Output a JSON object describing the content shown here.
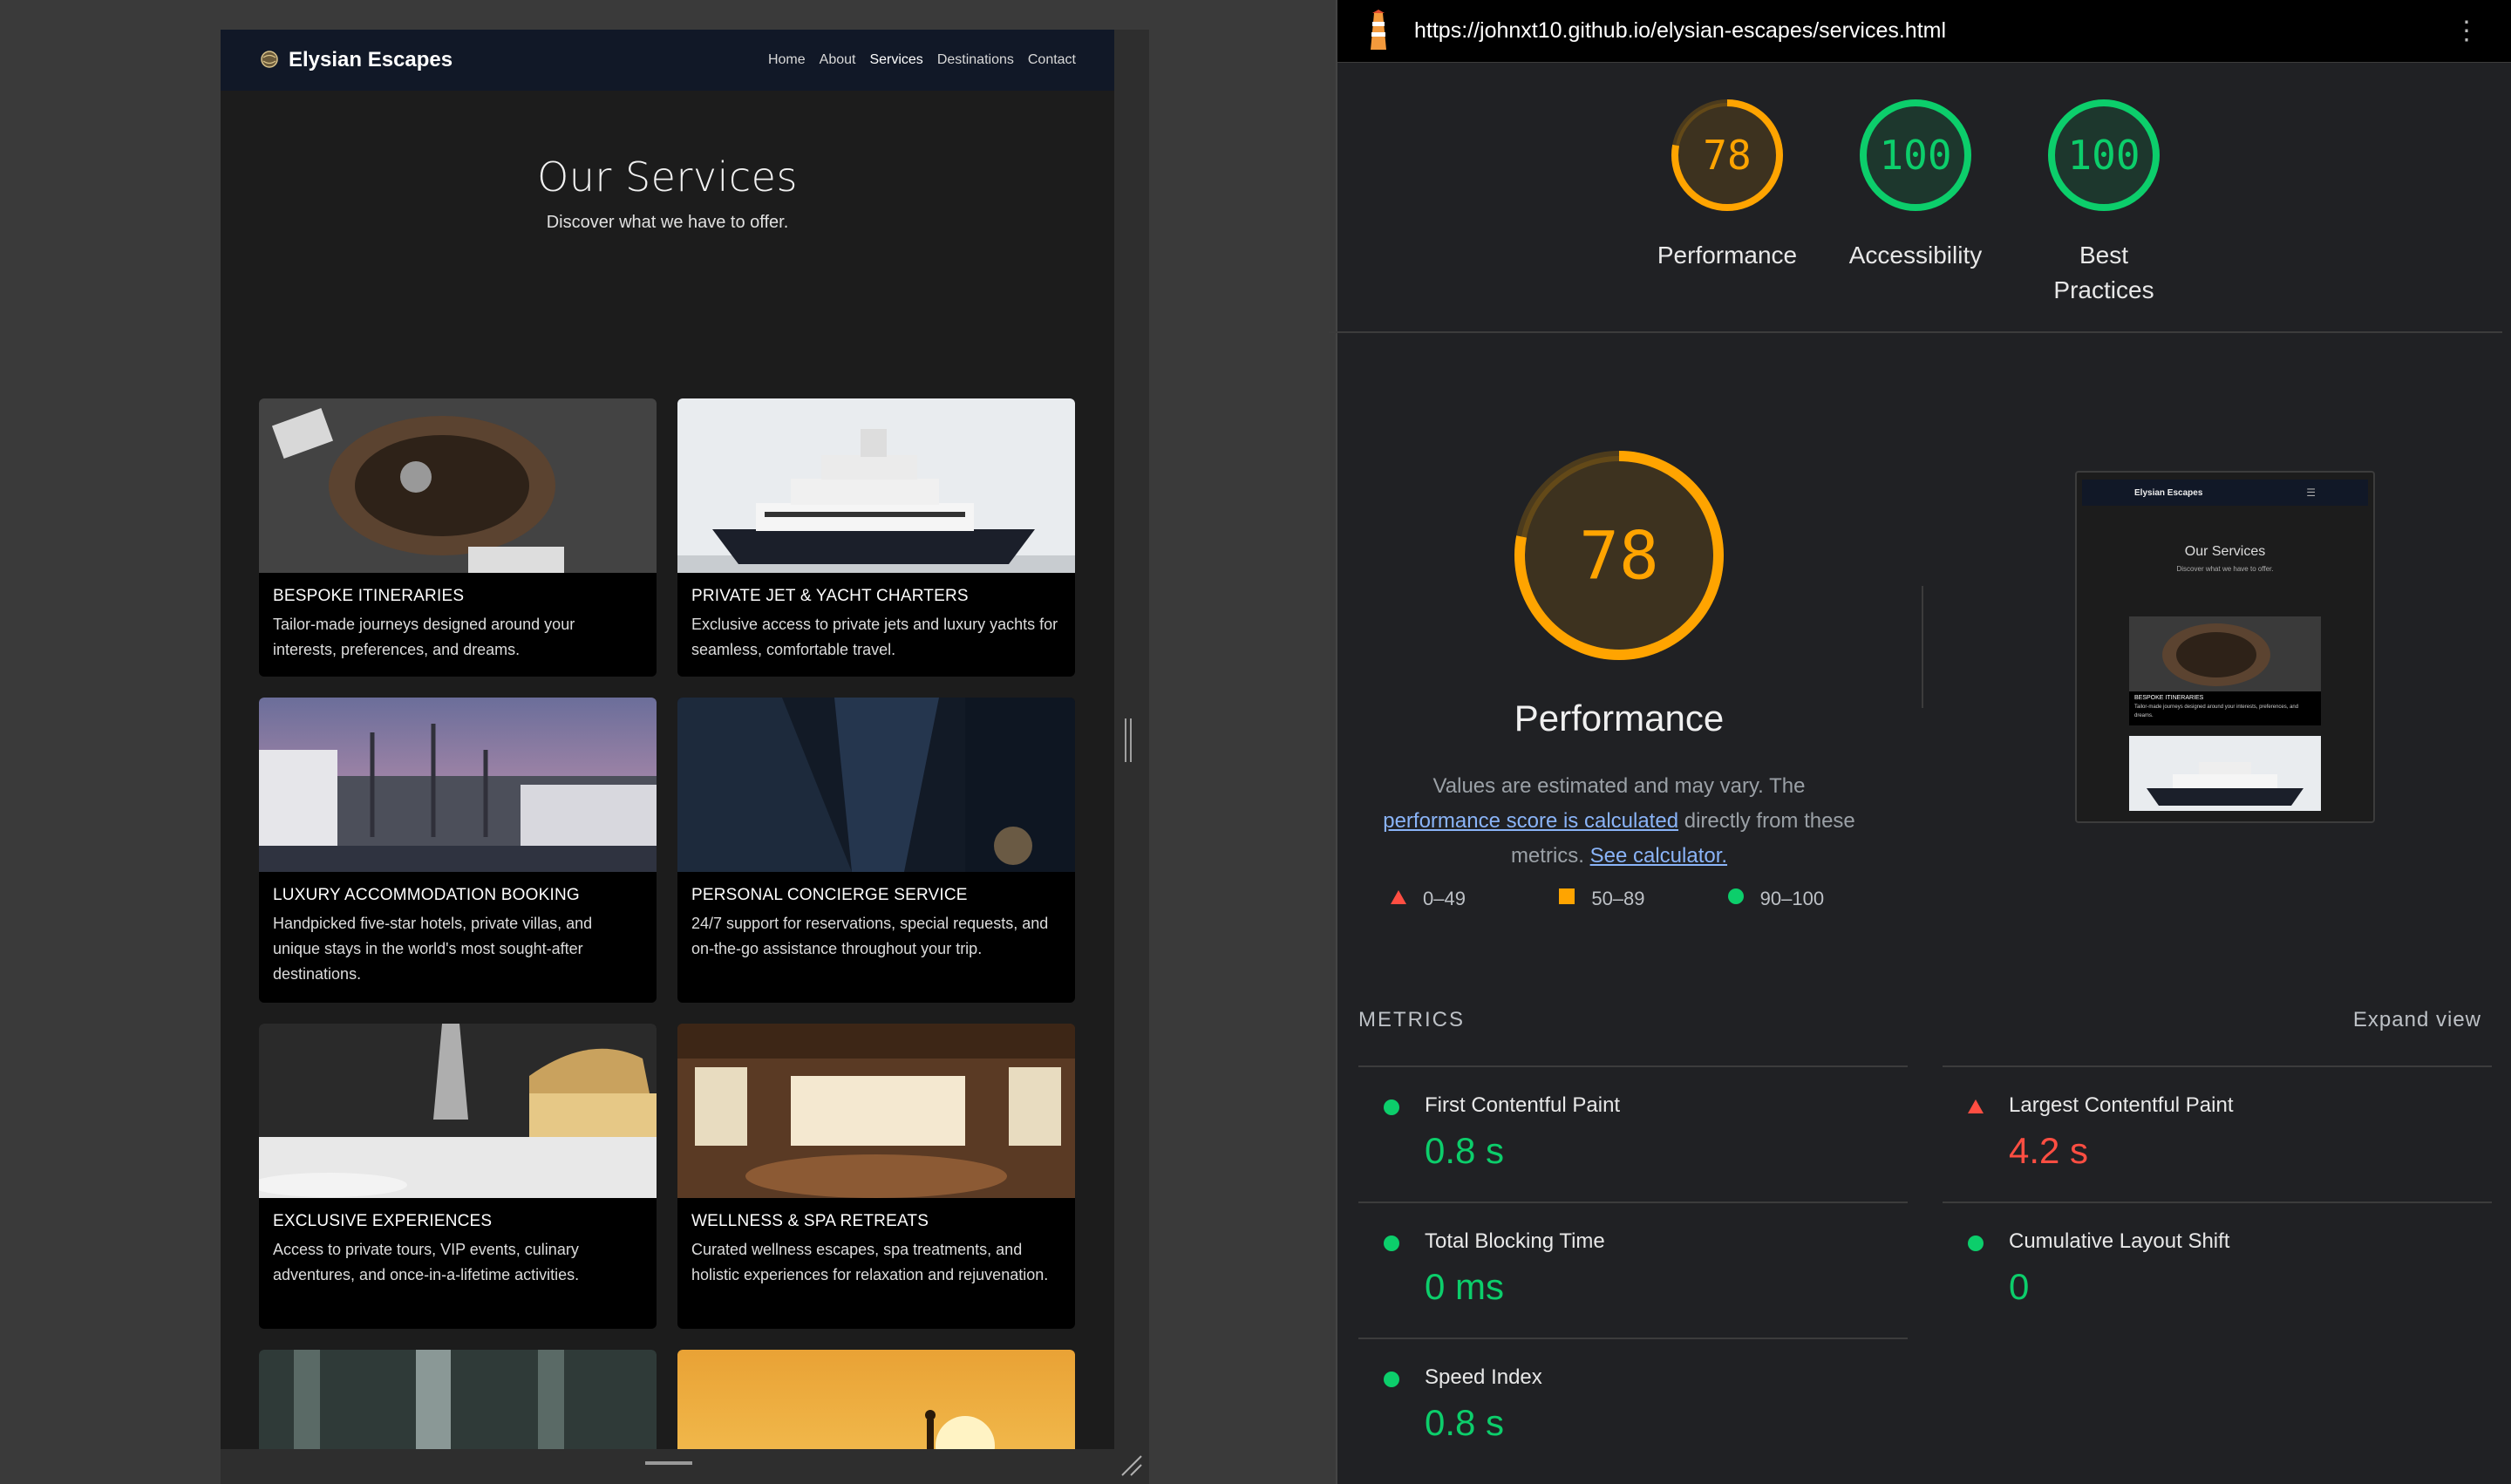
{
  "site": {
    "brand": "Elysian Escapes",
    "nav": [
      "Home",
      "About",
      "Services",
      "Destinations",
      "Contact"
    ],
    "active_nav": "Services",
    "hero_title": "Our Services",
    "hero_subtitle": "Discover what we have to offer.",
    "cards": [
      {
        "title": "BESPOKE ITINERARIES",
        "desc": "Tailor-made journeys designed around your interests, preferences, and dreams."
      },
      {
        "title": "PRIVATE JET & YACHT CHARTERS",
        "desc": "Exclusive access to private jets and luxury yachts for seamless, comfortable travel."
      },
      {
        "title": "LUXURY ACCOMMODATION BOOKING",
        "desc": "Handpicked five-star hotels, private villas, and unique stays in the world's most sought-after destinations."
      },
      {
        "title": "PERSONAL CONCIERGE SERVICE",
        "desc": "24/7 support for reservations, special requests, and on-the-go assistance throughout your trip."
      },
      {
        "title": "EXCLUSIVE EXPERIENCES",
        "desc": "Access to private tours, VIP events, culinary adventures, and once-in-a-lifetime activities."
      },
      {
        "title": "WELLNESS & SPA RETREATS",
        "desc": "Curated wellness escapes, spa treatments, and holistic experiences for relaxation and rejuvenation."
      }
    ]
  },
  "lighthouse": {
    "url": "https://johnxt10.github.io/elysian-escapes/services.html",
    "scores": [
      {
        "label": "Performance",
        "value": "78",
        "fraction": 0.78,
        "color": "#ffa400"
      },
      {
        "label": "Accessibility",
        "value": "100",
        "fraction": 1.0,
        "color": "#0cce6b"
      },
      {
        "label": "Best Practices",
        "value": "100",
        "fraction": 1.0,
        "color": "#0cce6b"
      }
    ],
    "perf": {
      "score": "78",
      "title": "Performance",
      "desc_prefix": "Values are estimated and may vary. The ",
      "link1": "performance score is calculated",
      "desc_mid": " directly from these metrics. ",
      "link2": "See calculator."
    },
    "legend": [
      {
        "range": "0–49",
        "shape": "triangle",
        "color": "#ff4e42"
      },
      {
        "range": "50–89",
        "shape": "square",
        "color": "#ffa400"
      },
      {
        "range": "90–100",
        "shape": "circle",
        "color": "#0cce6b"
      }
    ],
    "thumb": {
      "brand": "Elysian Escapes",
      "menu": "☰",
      "title": "Our Services",
      "subtitle": "Discover what we have to offer.",
      "card_title": "BESPOKE ITINERARIES",
      "card_desc": "Tailor-made journeys designed around your interests, preferences, and dreams."
    },
    "metrics_title": "METRICS",
    "expand_label": "Expand view",
    "metrics": [
      {
        "name": "First Contentful Paint",
        "value": "0.8 s",
        "status": "good",
        "color": "#0cce6b"
      },
      {
        "name": "Largest Contentful Paint",
        "value": "4.2 s",
        "status": "poor",
        "color": "#ff4e42"
      },
      {
        "name": "Total Blocking Time",
        "value": "0 ms",
        "status": "good",
        "color": "#0cce6b"
      },
      {
        "name": "Cumulative Layout Shift",
        "value": "0",
        "status": "good",
        "color": "#0cce6b"
      },
      {
        "name": "Speed Index",
        "value": "0.8 s",
        "status": "good",
        "color": "#0cce6b"
      }
    ]
  }
}
